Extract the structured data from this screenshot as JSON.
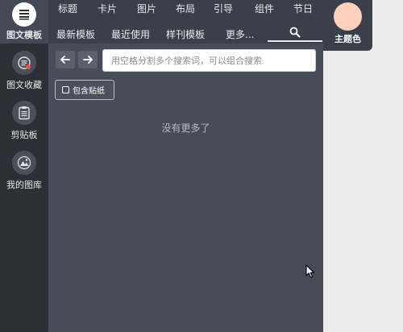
{
  "sidebar": {
    "items": [
      {
        "label": "图文模板",
        "icon": "template-list-icon",
        "active": true
      },
      {
        "label": "图文收藏",
        "icon": "favorites-icon",
        "active": false
      },
      {
        "label": "剪贴板",
        "icon": "clipboard-icon",
        "active": false
      },
      {
        "label": "我的图库",
        "icon": "image-library-icon",
        "active": false
      }
    ]
  },
  "topnav": {
    "row1": [
      "标题",
      "卡片",
      "图片",
      "布局",
      "引导",
      "组件",
      "节日"
    ],
    "row2": [
      "最新模板",
      "最近使用",
      "样刊模板",
      "更多..."
    ],
    "search_icon": "search-icon"
  },
  "theme": {
    "label": "主题色",
    "color": "#fcd0bd"
  },
  "toolbar": {
    "back_icon": "arrow-left-icon",
    "forward_icon": "arrow-right-icon",
    "search_placeholder": "用空格分割多个搜索词，可以组合搜索",
    "sticker_label": "包含贴纸"
  },
  "content": {
    "empty_message": "没有更多了"
  },
  "colors": {
    "sidebar_bg": "#2c2f36",
    "panel_bg": "#464c58",
    "nav_bg": "#3a3f4a",
    "theme_swatch": "#fcd0bd",
    "favorites_badge": "#e05a4e"
  }
}
